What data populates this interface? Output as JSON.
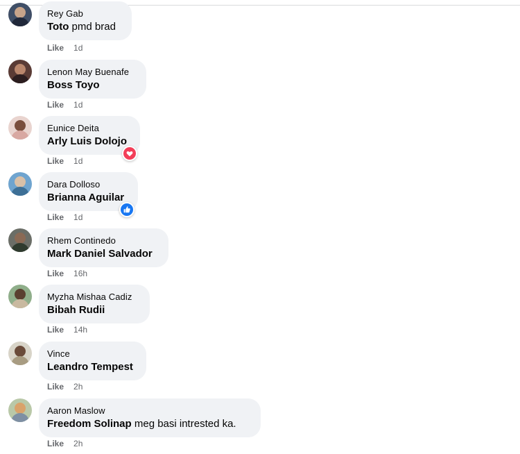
{
  "actions": {
    "like_label": "Like"
  },
  "colors": {
    "bubble": "#f0f2f5",
    "meta_text": "#65676b",
    "love_reaction": "#f33e58",
    "like_reaction": "#1877f2"
  },
  "comments": [
    {
      "author": "Rey Gab",
      "mention": "Toto",
      "text": " pmd brad",
      "time": "1d"
    },
    {
      "author": "Lenon May Buenafe",
      "mention": "Boss Toyo",
      "text": "",
      "time": "1d"
    },
    {
      "author": "Eunice Deita",
      "mention": "Arly Luis Dolojo",
      "text": "",
      "time": "1d",
      "reaction": "love-icon"
    },
    {
      "author": "Dara Dolloso",
      "mention": "Brianna Aguilar",
      "text": "",
      "time": "1d",
      "reaction": "like-icon"
    },
    {
      "author": "Rhem Continedo",
      "mention": "Mark Daniel Salvador",
      "text": "",
      "time": "16h"
    },
    {
      "author": "Myzha Mishaa Cadiz",
      "mention": "Bibah Rudii",
      "text": "",
      "time": "14h"
    },
    {
      "author": "Vince",
      "mention": "Leandro Tempest",
      "text": "",
      "time": "2h"
    },
    {
      "author": "Aaron Maslow",
      "mention": "Freedom Solinap",
      "text": " meg basi intrested ka.",
      "time": "2h"
    }
  ]
}
